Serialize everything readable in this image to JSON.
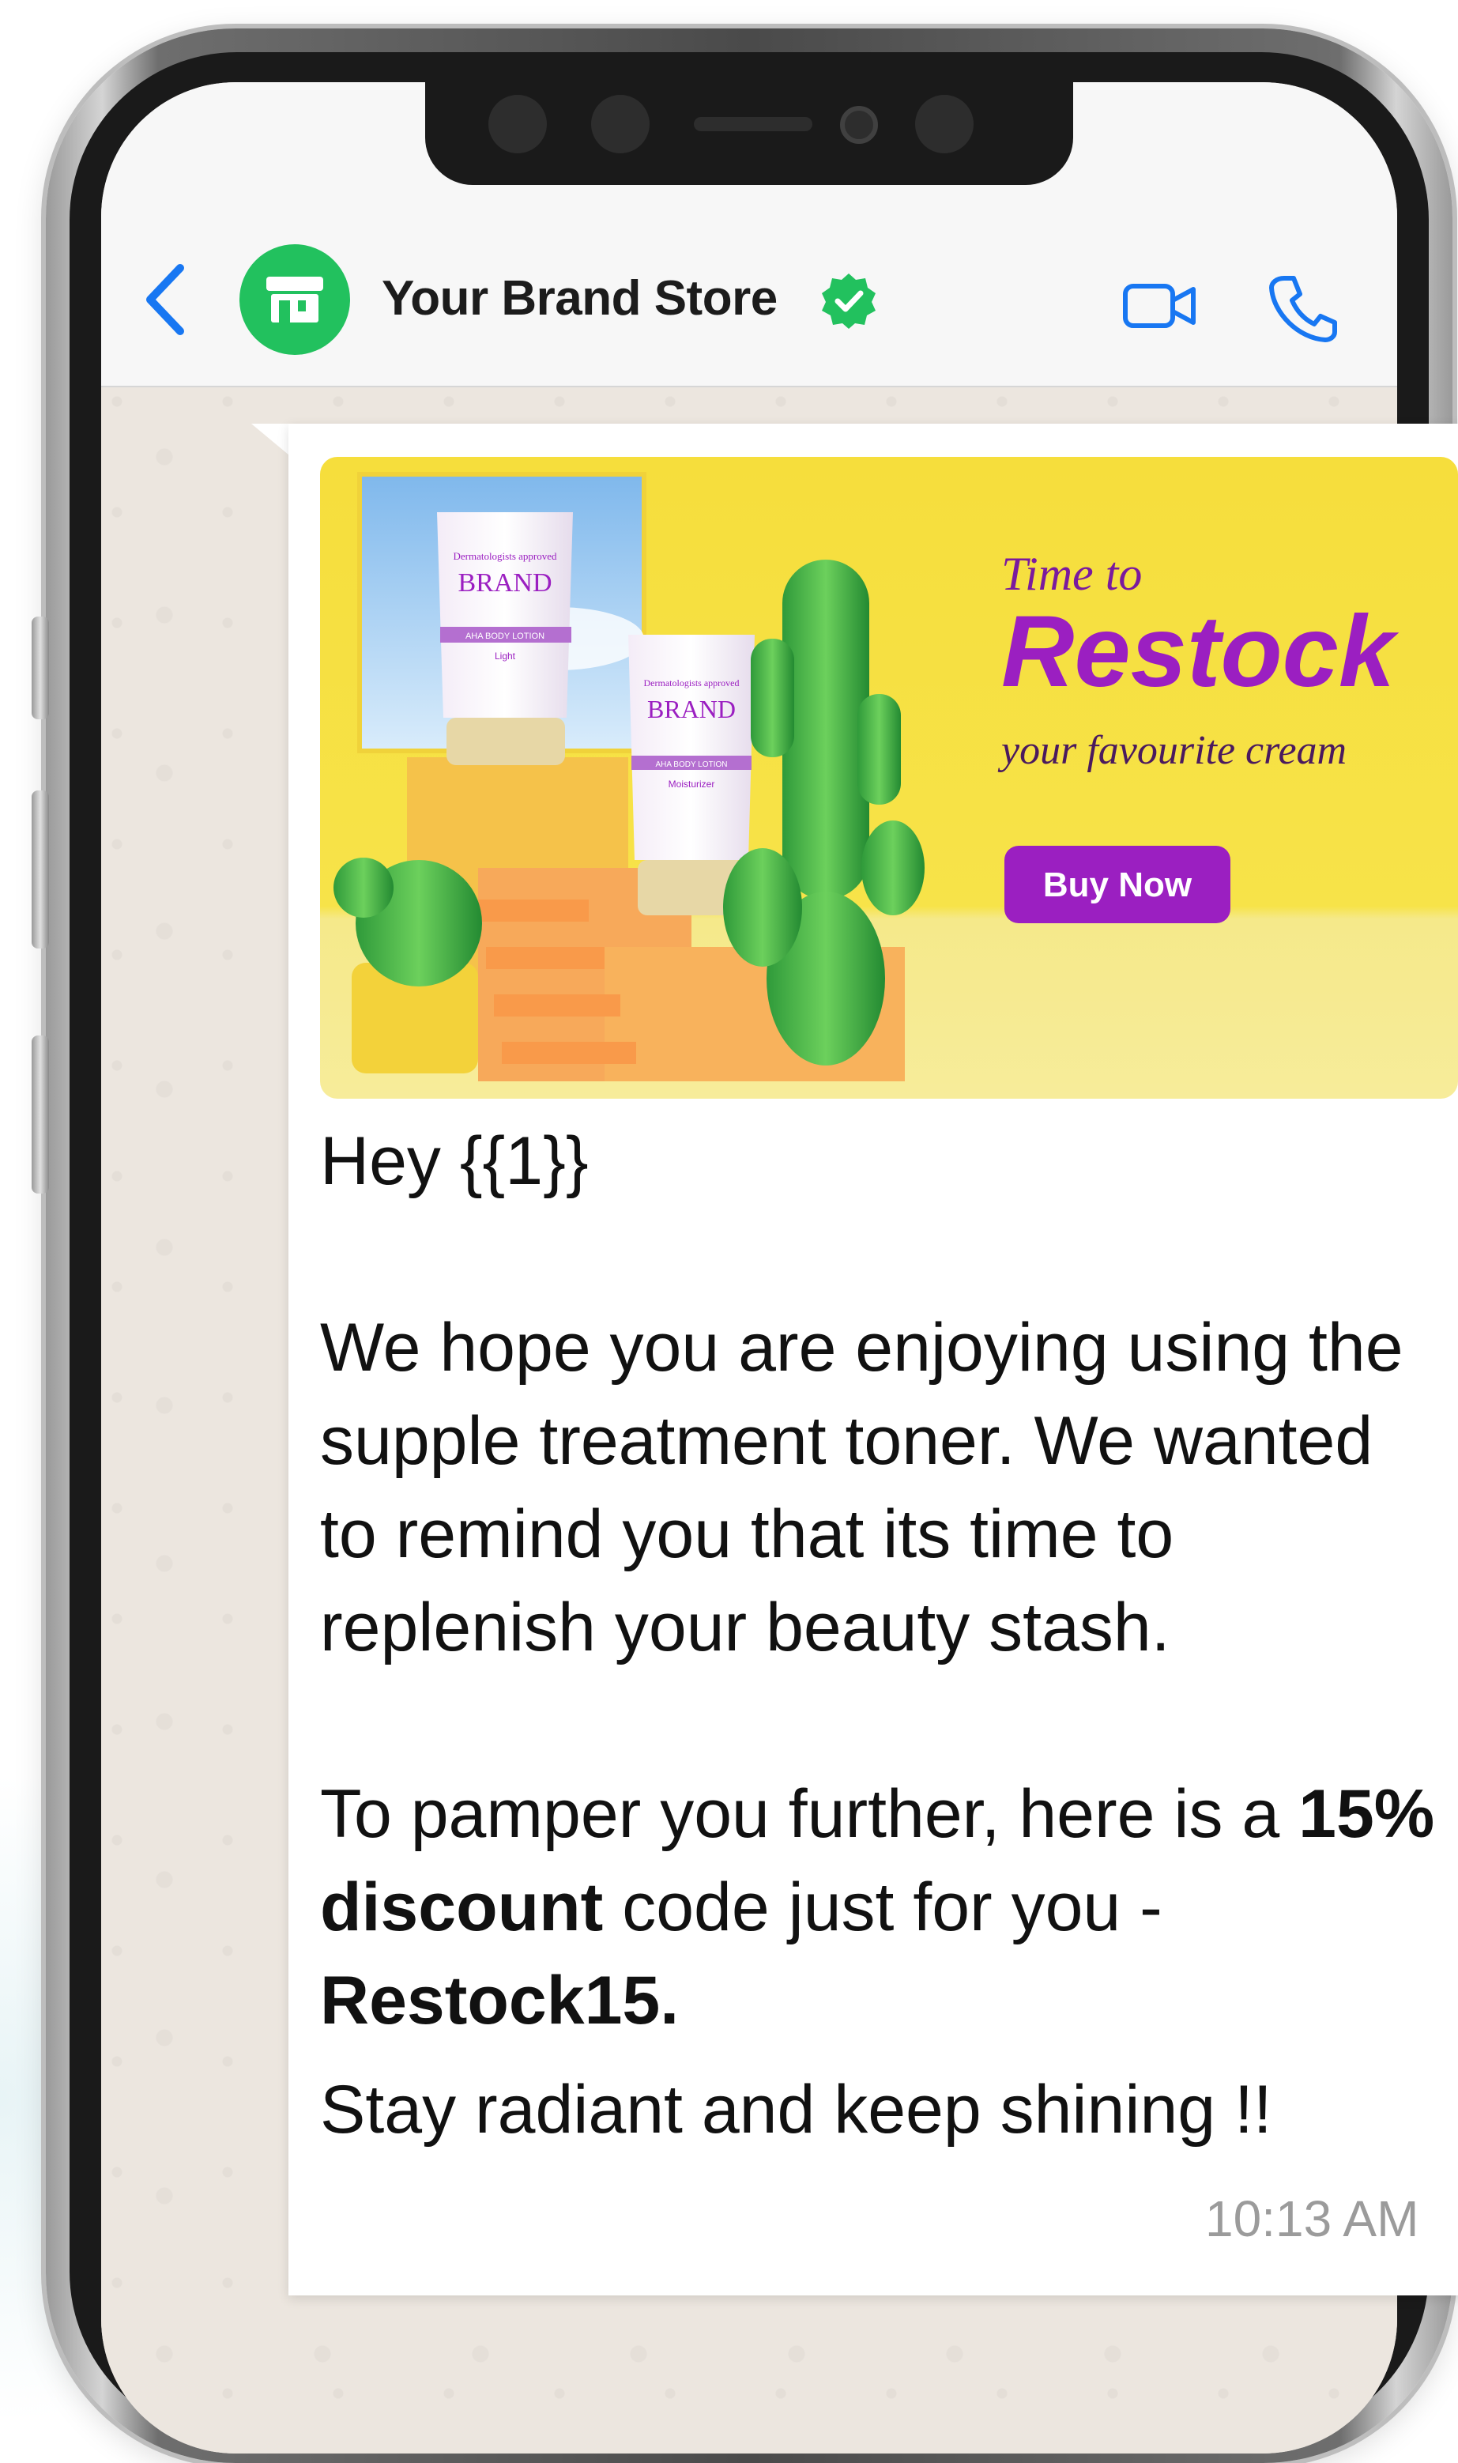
{
  "header": {
    "store_name": "Your Brand Store",
    "verified": true,
    "icons": [
      "back-chevron-icon",
      "store-icon",
      "verified-badge-icon",
      "video-call-icon",
      "phone-call-icon"
    ]
  },
  "banner": {
    "line1": "Time to",
    "line2": "Restock",
    "line3": "your favourite cream",
    "button": "Buy Now",
    "tube_brand": "BRAND",
    "tube1_sub": "Dermatologists approved",
    "tube1_line": "AHA BODY LOTION",
    "tube1_variant": "Light",
    "tube2_sub": "Dermatologists approved",
    "tube2_line": "AHA BODY LOTION",
    "tube2_variant": "Moisturizer"
  },
  "message": {
    "greeting": "Hey {{1}}",
    "paragraph1": "We hope you are enjoying using the supple treatment toner. We wanted to remind you that its time to replenish your beauty stash.",
    "p2_lead": "To pamper you further, here is a ",
    "p2_bold1": "15% discount",
    "p2_mid": " code just for you -",
    "p2_bold2": "Restock15.",
    "closing": "Stay radiant and keep shining !!",
    "time": "10:13 AM"
  },
  "colors": {
    "accent_blue": "#1877f2",
    "whatsapp_green": "#22c15e",
    "banner_yellow": "#f6de3c",
    "restock_purple": "#9b1fc1"
  }
}
